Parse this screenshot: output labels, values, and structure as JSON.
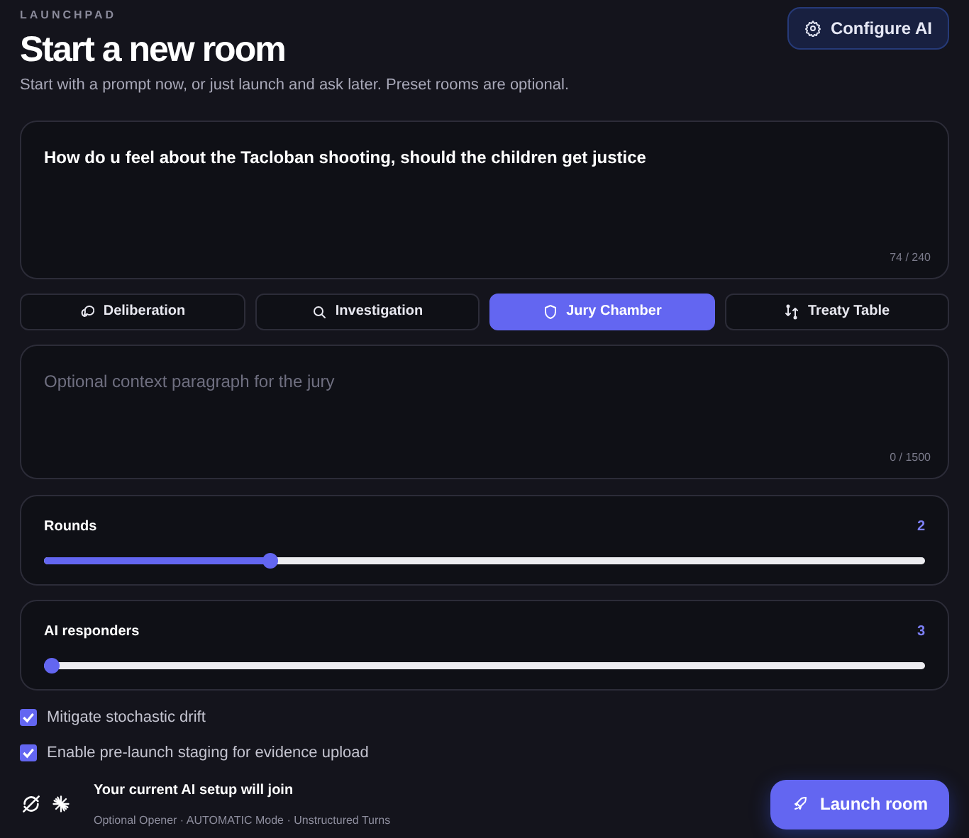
{
  "header": {
    "eyebrow": "LAUNCHPAD",
    "title": "Start a new room",
    "subtitle": "Start with a prompt now, or just launch and ask later. Preset rooms are optional.",
    "configure_button": "Configure AI"
  },
  "prompt": {
    "value": "How do u feel about the Tacloban shooting, should the children get justice",
    "counter": "74 / 240"
  },
  "presets": [
    {
      "label": "Deliberation",
      "kind": "chat",
      "selected": false
    },
    {
      "label": "Investigation",
      "kind": "search",
      "selected": false
    },
    {
      "label": "Jury Chamber",
      "kind": "shield",
      "selected": true
    },
    {
      "label": "Treaty Table",
      "kind": "swap",
      "selected": false
    }
  ],
  "context": {
    "placeholder": "Optional context paragraph for the jury",
    "counter": "0 / 1500"
  },
  "sliders": [
    {
      "label": "Rounds",
      "value": "2",
      "level": 0.253
    },
    {
      "label": "AI responders",
      "value": "3",
      "level": 0
    }
  ],
  "options": [
    {
      "label": "Mitigate stochastic drift",
      "checked": true
    },
    {
      "label": "Enable pre-launch staging for evidence upload",
      "checked": true
    }
  ],
  "footer": {
    "title": "Your current AI setup will join",
    "details": "Optional Opener · AUTOMATIC Mode · Unstructured Turns",
    "launch_button": "Launch room"
  }
}
